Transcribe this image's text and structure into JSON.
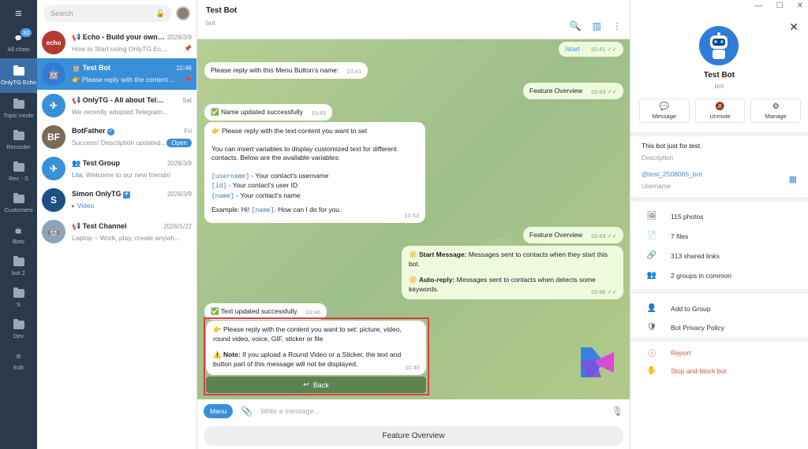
{
  "rail": {
    "badge": "32",
    "folders": [
      {
        "label": "All chats"
      },
      {
        "label": "OnlyTG Echo"
      },
      {
        "label": "Topic mode"
      },
      {
        "label": "Recorder"
      },
      {
        "label": "Rec - S"
      },
      {
        "label": "Customers"
      },
      {
        "label": "Bots"
      },
      {
        "label": "bot 2"
      },
      {
        "label": "S"
      },
      {
        "label": "Dev"
      },
      {
        "label": "Edit"
      }
    ]
  },
  "search": {
    "placeholder": "Search"
  },
  "chats": [
    {
      "name": "Echo - Build your own s...",
      "date": "2026/3/9",
      "preview": "How to Start using OnlyTG Ec...",
      "avatar_text": "echo",
      "avatar_color": "#b23a2e"
    },
    {
      "name": "Test Bot",
      "date": "10:46",
      "preview": "👉 Please reply with the content ...",
      "avatar_text": "🤖",
      "avatar_color": "#2f7dd8"
    },
    {
      "name": "OnlyTG - All about Telegram",
      "date": "Sat",
      "preview": "We recently adopted Telegram...",
      "avatar_text": "✈",
      "avatar_color": "#3a8fd9"
    },
    {
      "name": "BotFather",
      "date": "Fri",
      "preview": "Success! Description updated...",
      "pill": "Open",
      "avatar_text": "BF",
      "avatar_color": "#7b6b55"
    },
    {
      "name": "Test Group",
      "date": "2026/3/9",
      "sender": "Lila:",
      "preview": "Welcome to our new friends!",
      "avatar_text": "✈",
      "avatar_color": "#3a8fd9"
    },
    {
      "name": "Simon OnlyTG",
      "date": "2026/3/9",
      "preview": "Video",
      "avatar_text": "S",
      "avatar_color": "#1d4f86"
    },
    {
      "name": "Test Channel",
      "date": "2026/1/22",
      "preview": "Laptop – Work, play, create anywh...",
      "avatar_text": "🤖",
      "avatar_color": "#8da3b8"
    }
  ],
  "header": {
    "title": "Test Bot",
    "subtitle": "bot"
  },
  "messages": {
    "m1": {
      "text": "/start",
      "time": "10:41"
    },
    "m2": {
      "text": "Please reply with this Menu Button's name:",
      "time": "10:41"
    },
    "m3": {
      "text": "Feature Overview",
      "time": "10:43"
    },
    "m4": {
      "text": "✅ Name updated successfully",
      "time": "10:43"
    },
    "m5": {
      "line1": "👉 Please reply with the text content you want to set",
      "line2": "You can insert variables to display customized text for different contacts. Below are the available variables:",
      "v1": "[username]",
      "v1d": " - Your contact's username",
      "v2": "[id]",
      "v2d": " - Your contact's user ID",
      "v3": "[name]",
      "v3d": " - Your contact's name",
      "ex_a": "Example: Hi! ",
      "ex_var": "[name]",
      "ex_b": ". How can I do for you.",
      "time": "10:43"
    },
    "m6": {
      "text": "Feature Overview",
      "time": "10:43"
    },
    "m7": {
      "a_bold": "Start Message:",
      "a_text": " Messages sent to contacts when they start this bot.",
      "b_bold": "Auto-reply:",
      "b_text": " Messages sent to contacts when detects some keywords.",
      "time": "10:46"
    },
    "m8": {
      "text": "✅ Text updated successfully",
      "time": "10:46"
    },
    "m9": {
      "line1": "👉 Please reply with the content you want to set: picture, video, round video, voice, GIF, sticker or file",
      "note_bold": "Note:",
      "note_text": " If you upload a Round Video or a Sticker, the text and button part of this message will not be displayed.",
      "time": "10:46"
    },
    "back_button": "Back"
  },
  "composer": {
    "menu": "Menu",
    "placeholder": "Write a message..."
  },
  "keyboard": {
    "button": "Feature Overview"
  },
  "info": {
    "name": "Test Bot",
    "sub": "bot",
    "actions": [
      "Message",
      "Unmute",
      "Manage"
    ],
    "description": "This bot just for test.",
    "description_label": "Description",
    "username": "@test_2508065_bot",
    "username_label": "Username",
    "media": [
      "115 photos",
      "7 files",
      "313 shared links",
      "2 groups in common"
    ],
    "more": [
      "Add to Group",
      "Bot Privacy Policy"
    ],
    "danger": [
      "Report",
      "Stop and block bot"
    ]
  }
}
